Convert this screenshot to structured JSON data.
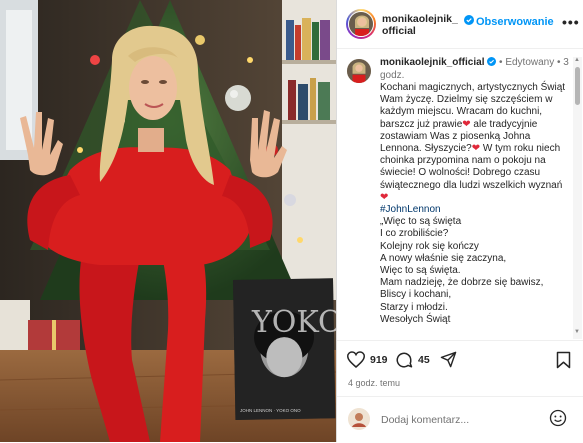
{
  "header": {
    "username": "monikaolejnik_official",
    "follow_label": "Obserwowanie",
    "more_icon": "•••"
  },
  "comment": {
    "username": "monikaolejnik_official",
    "edited": "• Edytowany",
    "time": "• 3 godz.",
    "lines": [
      {
        "text": "Kochani magicznych, artystycznych Świąt Wam życzę. Dzielmy się szczęściem w każdym miejscu. Wracam do kuchni, barszcz już prawie",
        "heart": true
      },
      {
        "text": " ale tradycyjnie zostawiam Was z piosenką Johna Lennona. Słyszycie?",
        "heart": true
      },
      {
        "text": " W tym roku niech choinka przypomina nam o pokoju na świecie! O wolności! Dobrego czasu świątecznego dla ludzi wszelkich wyznań",
        "heart": true
      }
    ],
    "hashtag": "#JohnLennon",
    "poem": [
      "„Więc to są święta",
      "I co zrobiliście?",
      "Kolejny rok się kończy",
      "A nowy właśnie się zaczyna,",
      "Więc to są święta.",
      "Mam nadzieję, że dobrze się bawisz,",
      "Bliscy i kochani,",
      "Starzy i młodzi.",
      "Wesołych Świąt"
    ]
  },
  "actions": {
    "likes": "919",
    "comments": "45"
  },
  "timestamp": "4 godz. temu",
  "add_comment": {
    "placeholder": "Dodaj komentarz..."
  },
  "photo": {
    "book_title": "YOKO",
    "book_author": "JOHN LENNON · YOKO ONO",
    "colors": {
      "dress": "#d81e1e",
      "tree": "#2f5a2a",
      "floor": "#8a5a35"
    }
  }
}
